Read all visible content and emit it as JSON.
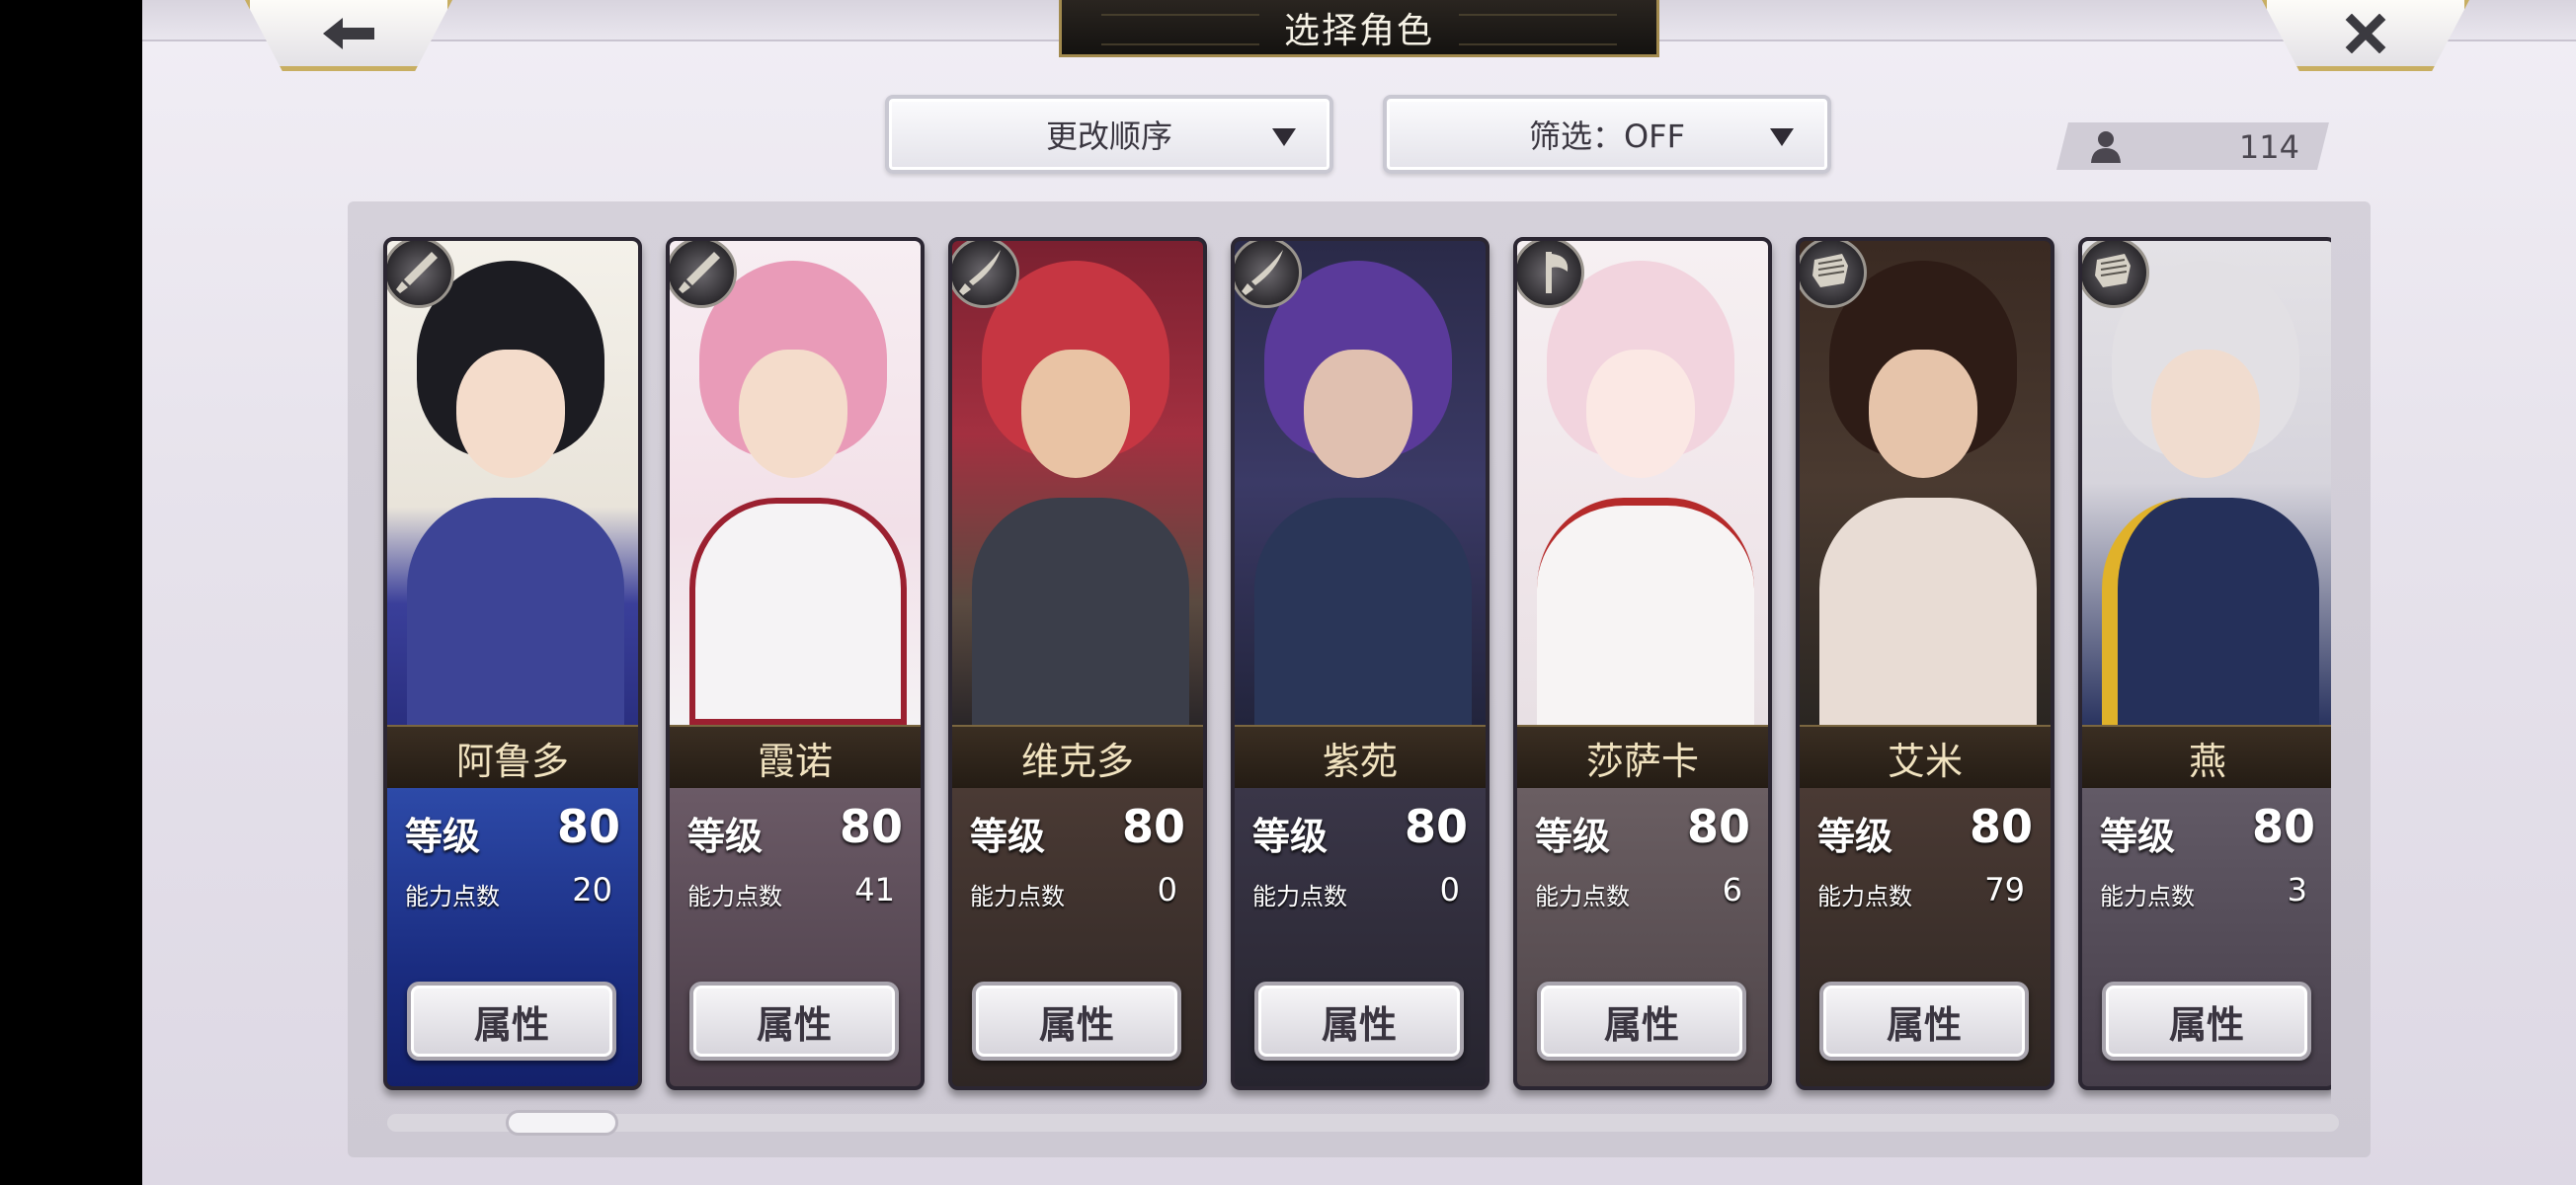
{
  "header": {
    "title": "选择角色",
    "back_icon": "back-arrow-icon",
    "close_icon": "close-x-icon"
  },
  "toolbar": {
    "sort_label": "更改顺序",
    "filter_label": "筛选：OFF",
    "character_count": "114"
  },
  "colors": {
    "gold_accent": "#c8ae62",
    "panel": "#d5d1da",
    "title_plate": "#1e1a16"
  },
  "roster": {
    "level_label": "等级",
    "ability_label": "能力点数",
    "attr_button_label": "属性",
    "characters": [
      {
        "name": "阿鲁多",
        "level": "80",
        "ability_points": "20",
        "class_icon": "sword-icon"
      },
      {
        "name": "霞诺",
        "level": "80",
        "ability_points": "41",
        "class_icon": "sword-icon"
      },
      {
        "name": "维克多",
        "level": "80",
        "ability_points": "0",
        "class_icon": "katana-icon"
      },
      {
        "name": "紫苑",
        "level": "80",
        "ability_points": "0",
        "class_icon": "katana-icon"
      },
      {
        "name": "莎萨卡",
        "level": "80",
        "ability_points": "6",
        "class_icon": "axe-icon"
      },
      {
        "name": "艾米",
        "level": "80",
        "ability_points": "79",
        "class_icon": "gauntlet-icon"
      },
      {
        "name": "燕",
        "level": "80",
        "ability_points": "3",
        "class_icon": "gauntlet-icon"
      }
    ]
  }
}
